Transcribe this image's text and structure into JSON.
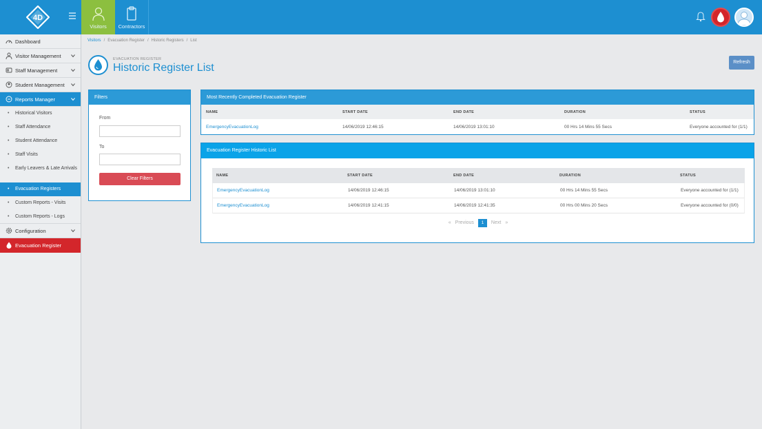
{
  "topbar": {
    "tabs": [
      {
        "label": "Visitors"
      },
      {
        "label": "Contractors"
      }
    ]
  },
  "sidebar": {
    "items": [
      {
        "label": "Dashboard"
      },
      {
        "label": "Visitor Management"
      },
      {
        "label": "Staff Management"
      },
      {
        "label": "Student Management"
      },
      {
        "label": "Reports Manager"
      }
    ],
    "sub_items": [
      {
        "label": "Historical Visitors"
      },
      {
        "label": "Staff Attendance"
      },
      {
        "label": "Student Attendance"
      },
      {
        "label": "Staff Visits"
      },
      {
        "label": "Early Leavers & Late Arrivals"
      },
      {
        "label": "Evacuation Registers"
      },
      {
        "label": "Custom Reports - Visits"
      },
      {
        "label": "Custom Reports - Logs"
      }
    ],
    "config_label": "Configuration",
    "evac_label": "Evacuation Register"
  },
  "breadcrumb": [
    "Visitors",
    "Evacuation Register",
    "Historic Registers",
    "List"
  ],
  "page": {
    "subtitle": "EVACUATION REGISTER",
    "title": "Historic Register List",
    "refresh_label": "Refresh"
  },
  "filters": {
    "title": "Filters",
    "from_label": "From",
    "from_value": "",
    "to_label": "To",
    "to_value": "",
    "clear_label": "Clear Filters"
  },
  "recent": {
    "title": "Most Recently Completed Evacuation Register",
    "columns": [
      "NAME",
      "START DATE",
      "END DATE",
      "DURATION",
      "STATUS"
    ],
    "row": [
      "EmergencyEvacuationLog",
      "14/06/2019 12:46:15",
      "14/06/2019 13:01:10",
      "00 Hrs 14 Mins 55 Secs",
      "Everyone accounted for (1/1)"
    ]
  },
  "history": {
    "title": "Evacuation Register Historic List",
    "columns": [
      "NAME",
      "START DATE",
      "END DATE",
      "DURATION",
      "STATUS"
    ],
    "rows": [
      [
        "EmergencyEvacuationLog",
        "14/06/2019 12:46:15",
        "14/06/2019 13:01:10",
        "00 Hrs 14 Mins 55 Secs",
        "Everyone accounted for (1/1)"
      ],
      [
        "EmergencyEvacuationLog",
        "14/06/2019 12:41:15",
        "14/06/2019 12:41:35",
        "00 Hrs 00 Mins 20 Secs",
        "Everyone accounted for (0/0)"
      ]
    ],
    "pager": {
      "prev": "«",
      "prev_label": "Previous",
      "current": "1",
      "next_label": "Next",
      "next": "»"
    }
  },
  "colors": {
    "primary": "#1d8fd1",
    "visitors_tab": "#8cbf3f",
    "danger": "#d3262b",
    "clear_button": "#d94b55"
  }
}
